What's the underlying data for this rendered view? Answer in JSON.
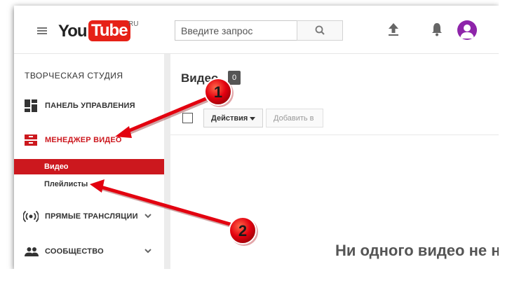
{
  "header": {
    "logo_you": "You",
    "logo_tube": "Tube",
    "logo_region": "RU",
    "search_placeholder": "Введите запрос"
  },
  "sidebar": {
    "title": "ТВОРЧЕСКАЯ СТУДИЯ",
    "items": [
      {
        "label": "ПАНЕЛЬ УПРАВЛЕНИЯ",
        "icon": "dashboard-icon"
      },
      {
        "label": "МЕНЕДЖЕР ВИДЕО",
        "icon": "video-manager-icon",
        "active": true
      },
      {
        "label": "ПРЯМЫЕ ТРАНСЛЯЦИИ",
        "icon": "live-broadcast-icon"
      },
      {
        "label": "СООБЩЕСТВО",
        "icon": "community-icon"
      }
    ],
    "subitems": [
      {
        "label": "Видео",
        "active": true
      },
      {
        "label": "Плейлисты"
      }
    ]
  },
  "main": {
    "title": "Видео",
    "count": "0",
    "actions_label": "Действия",
    "add_label": "Добавить в",
    "empty_message": "Ни одного видео не н"
  },
  "annotations": {
    "marker1": "1",
    "marker2": "2"
  },
  "colors": {
    "accent": "#cc181e",
    "logo_red": "#e62117",
    "avatar": "#8e24aa",
    "arrow": "#e3000f"
  }
}
